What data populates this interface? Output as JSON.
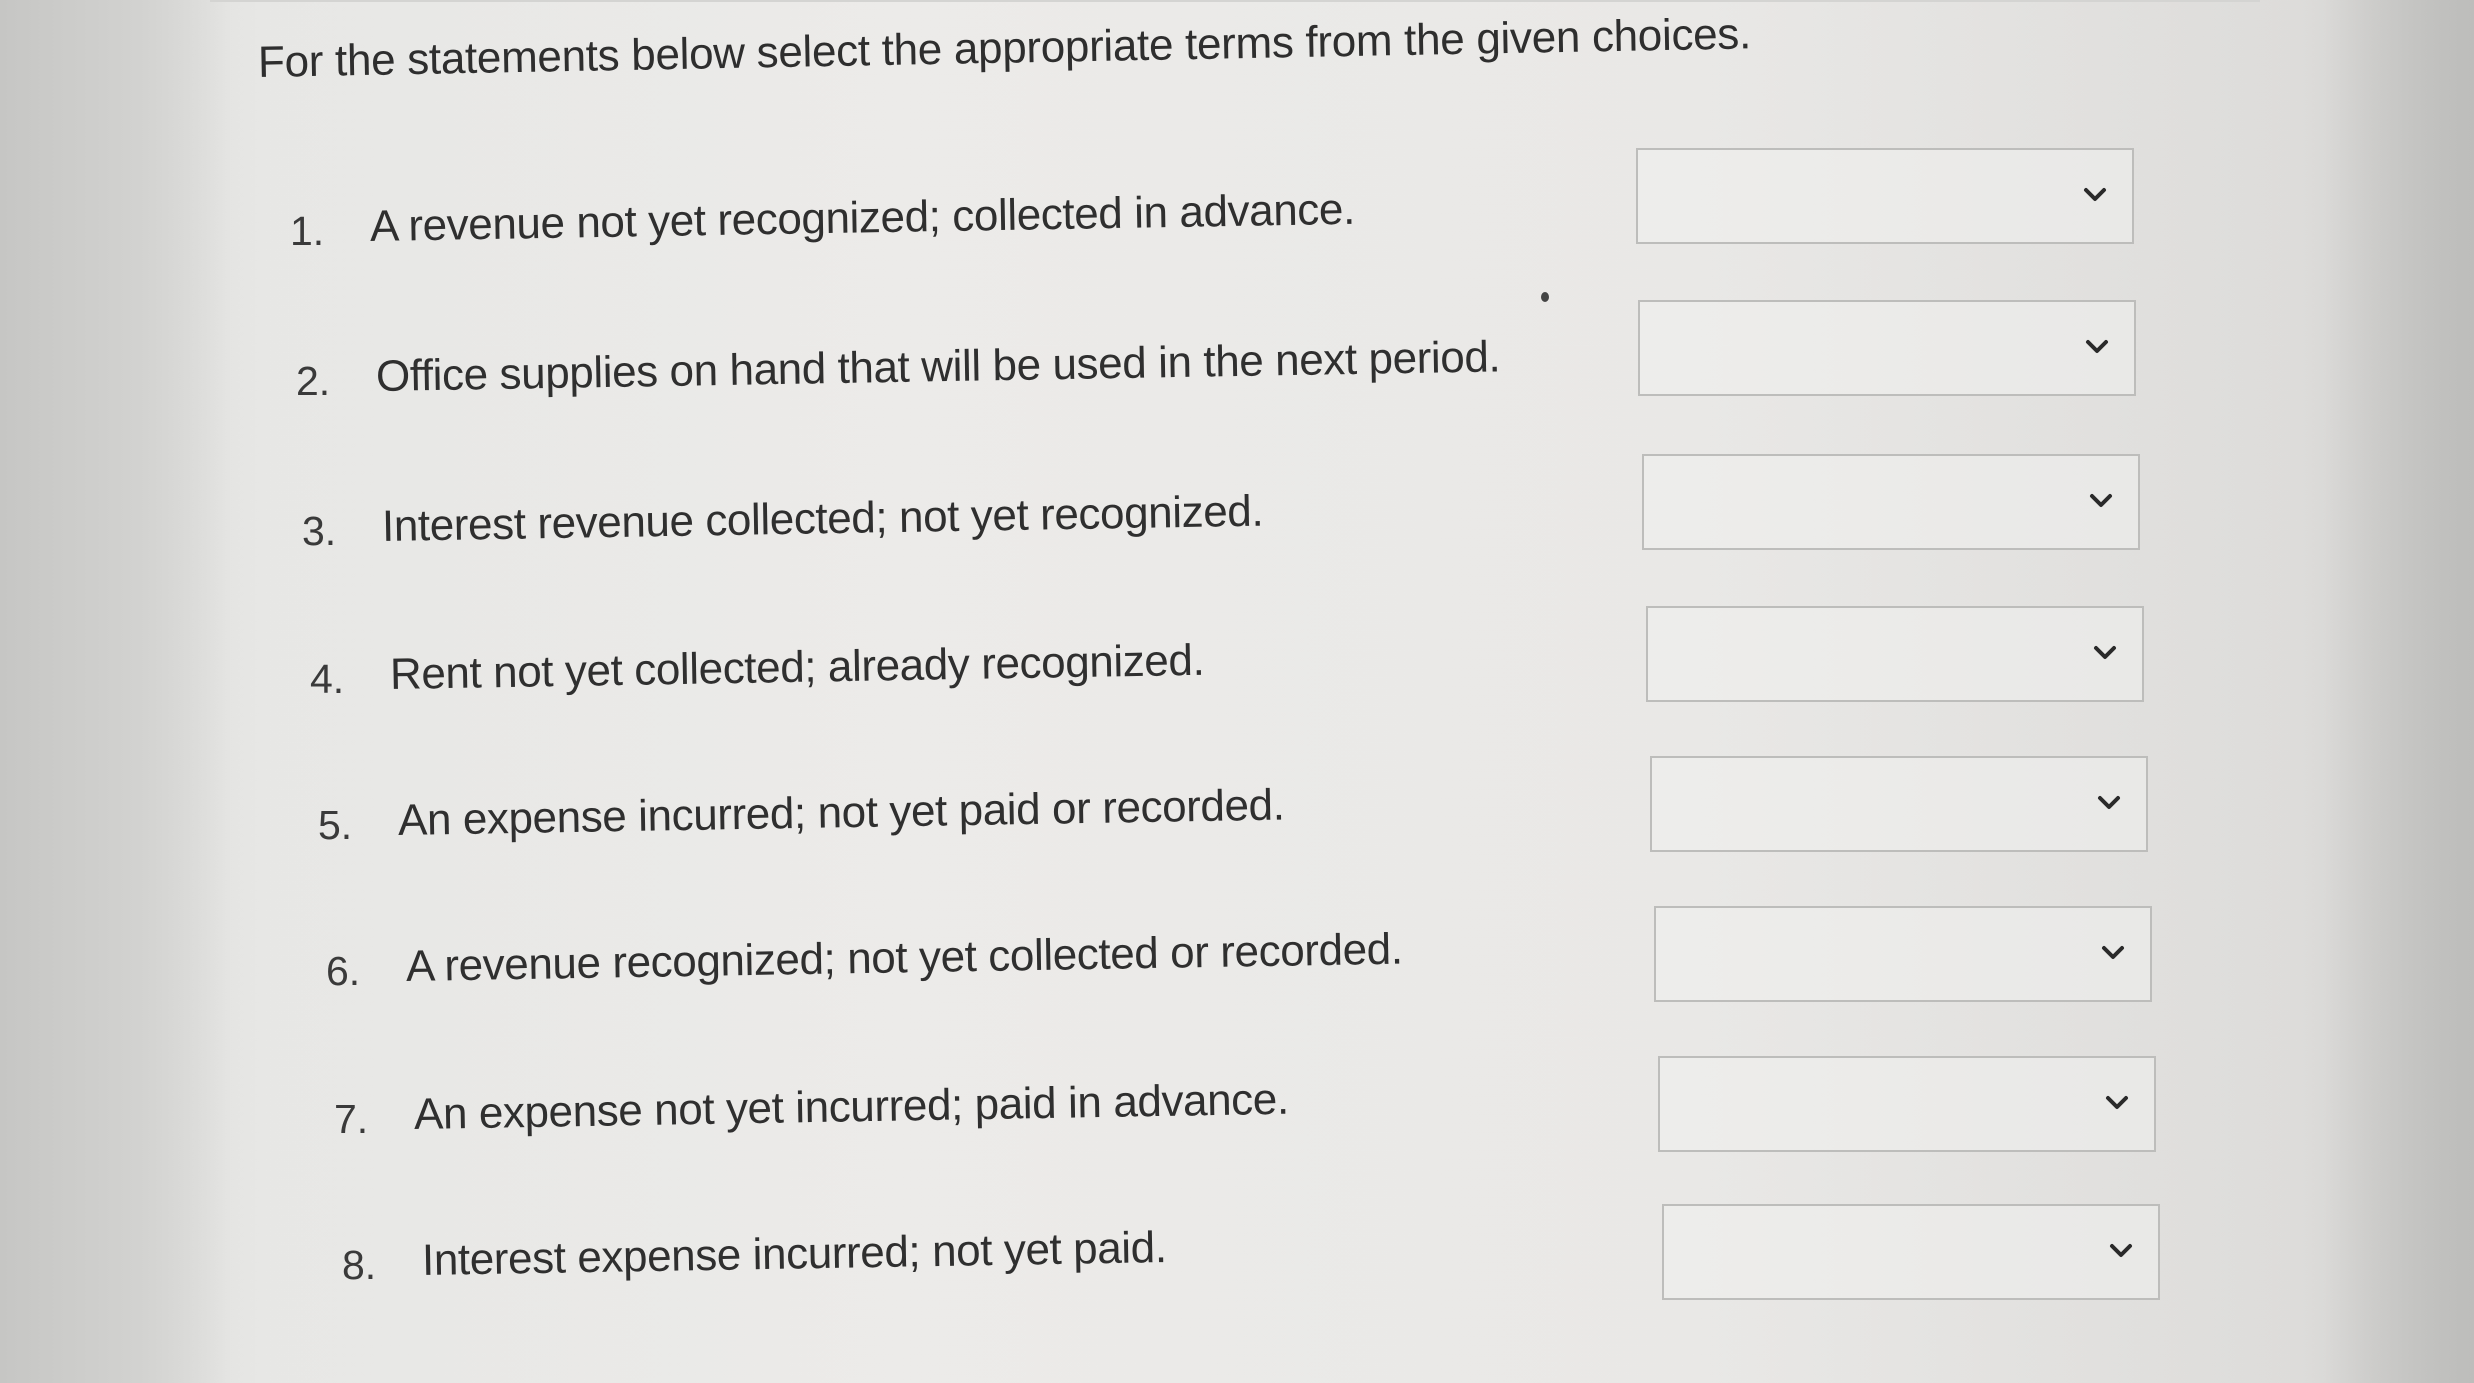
{
  "instructions": "For the statements below select the appropriate terms from the given choices.",
  "questions": [
    {
      "number": "1.",
      "text": "A revenue not yet recognized; collected in advance.",
      "selected": ""
    },
    {
      "number": "2.",
      "text": "Office supplies on hand that will be used in the next period.",
      "selected": ""
    },
    {
      "number": "3.",
      "text": "Interest revenue collected; not yet recognized.",
      "selected": ""
    },
    {
      "number": "4.",
      "text": "Rent not yet collected; already recognized.",
      "selected": ""
    },
    {
      "number": "5.",
      "text": "An expense incurred; not yet paid or recorded.",
      "selected": ""
    },
    {
      "number": "6.",
      "text": "A revenue recognized; not yet collected or recorded.",
      "selected": ""
    },
    {
      "number": "7.",
      "text": "An expense not yet incurred; paid in advance.",
      "selected": ""
    },
    {
      "number": "8.",
      "text": "Interest expense incurred; not yet paid.",
      "selected": ""
    }
  ],
  "dropdown_icon": "chevron-down-icon"
}
